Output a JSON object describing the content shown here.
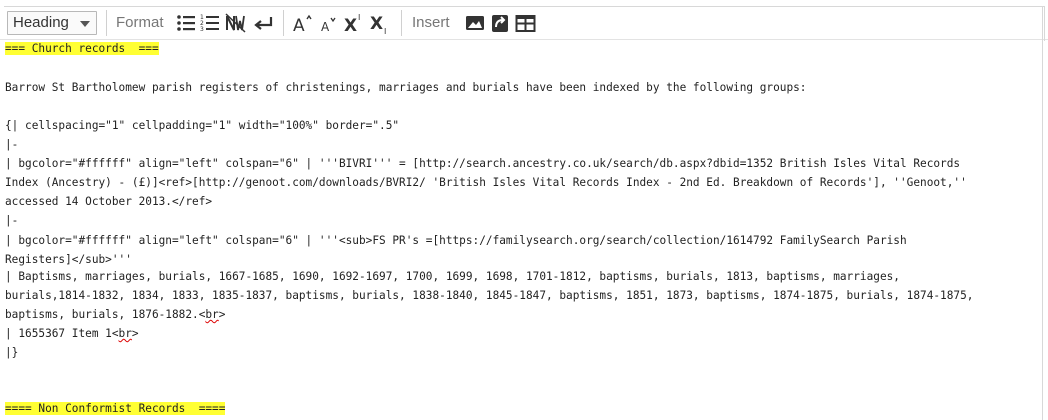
{
  "toolbar": {
    "heading_select": "Heading",
    "format_label": "Format",
    "insert_label": "Insert",
    "buttons": {
      "bulleted_list": "bulleted-list-icon",
      "numbered_list": "numbered-list-icon",
      "no_wiki": "nowiki-icon",
      "new_line": "newline-icon",
      "big": "big-text-icon",
      "small": "small-text-icon",
      "superscript": "superscript-icon",
      "subscript": "subscript-icon",
      "gallery": "gallery-icon",
      "redirect": "redirect-icon",
      "table": "table-icon"
    }
  },
  "editor": {
    "l1": "=== Church records  ===",
    "l2": "Barrow St Bartholomew parish registers of christenings, marriages and burials have been indexed by the following groups:",
    "l3": "{| cellspacing=\"1\" cellpadding=\"1\" width=\"100%\" border=\".5\"",
    "l4": "|-",
    "l5": "| bgcolor=\"#ffffff\" align=\"left\" colspan=\"6\" | '''BIVRI''' = [http://search.ancestry.co.uk/search/db.aspx?dbid=1352 British Isles Vital Records",
    "l6": "Index (Ancestry) - (£)]<ref>[http://genoot.com/downloads/BVRI2/ 'British Isles Vital Records Index - 2nd Ed. Breakdown of Records'], ''Genoot,''",
    "l7": "accessed 14 October 2013.</ref>",
    "l8": "|-",
    "l9": "| bgcolor=\"#ffffff\" align=\"left\" colspan=\"6\" | '''<sub>FS PR's =[https://familysearch.org/search/collection/1614792 FamilySearch Parish",
    "l10": "Registers]</sub>'''",
    "l11": "| Baptisms, marriages, burials, 1667-1685, 1690, 1692-1697, 1700, 1699, 1698, 1701-1812, baptisms, burials, 1813, baptisms, marriages,",
    "l12": "burials,1814-1832, 1834, 1833, 1835-1837, baptisms, burials, 1838-1840, 1845-1847, baptisms, 1851, 1873, baptisms, 1874-1875, burials, 1874-1875,",
    "l13a": "baptisms, burials, 1876-1882.<",
    "l13b": "br",
    "l13c": ">",
    "l14a": "| 1655367 Item 1<",
    "l14b": "br",
    "l14c": ">",
    "l15": "|}",
    "l16": "==== Non Conformist Records  ===="
  },
  "colors": {
    "highlight": "#ffff33",
    "toolbar_label": "#777777"
  }
}
